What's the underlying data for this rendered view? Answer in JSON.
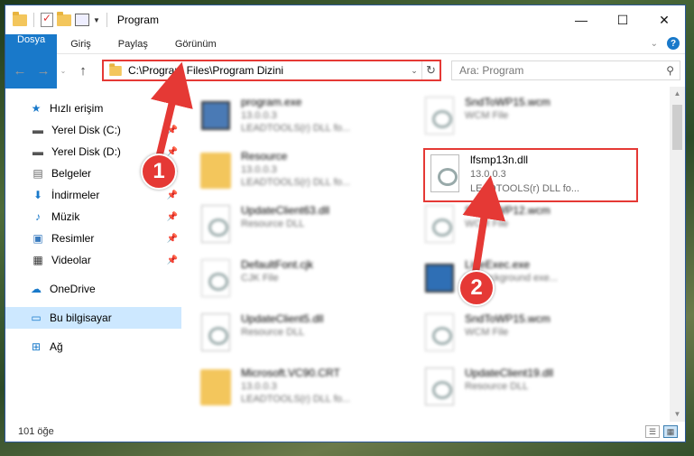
{
  "titlebar": {
    "title": "Program",
    "minimize": "—",
    "maximize": "☐",
    "close": "✕"
  },
  "ribbon": {
    "tabs": [
      "Dosya",
      "Giriş",
      "Paylaş",
      "Görünüm"
    ],
    "help": "?"
  },
  "navbar": {
    "back": "←",
    "forward": "→",
    "recent": "⌄",
    "up": "↑",
    "address": "C:\\Program Files\\Program Dizini",
    "refresh": "↻",
    "search_placeholder": "Ara: Program"
  },
  "sidebar": {
    "quick_access": "Hızlı erişim",
    "items": [
      {
        "label": "Yerel Disk (C:)",
        "icon": "drive-icon",
        "pinned": true
      },
      {
        "label": "Yerel Disk (D:)",
        "icon": "drive-icon",
        "pinned": true
      },
      {
        "label": "Belgeler",
        "icon": "documents-icon",
        "pinned": true
      },
      {
        "label": "İndirmeler",
        "icon": "download-icon",
        "pinned": true
      },
      {
        "label": "Müzik",
        "icon": "music-icon",
        "pinned": true
      },
      {
        "label": "Resimler",
        "icon": "pictures-icon",
        "pinned": true
      },
      {
        "label": "Videolar",
        "icon": "videos-icon",
        "pinned": true
      }
    ],
    "onedrive": "OneDrive",
    "this_pc": "Bu bilgisayar",
    "network": "Ağ"
  },
  "files": [
    {
      "name": "program.exe",
      "line1": "13.0.0.3",
      "line2": "LEADTOOLS(r) DLL fo...",
      "icon": "exe-icon"
    },
    {
      "name": "SndToWP15.wcm",
      "line1": "WCM File",
      "line2": "",
      "icon": "file-icon"
    },
    {
      "name": "Resource",
      "line1": "13.0.0.3",
      "line2": "LEADTOOLS(r) DLL fo...",
      "icon": "folder-icon"
    },
    {
      "name": "",
      "line1": "",
      "line2": "",
      "icon": ""
    },
    {
      "name": "UpdateClient63.dll",
      "line1": "Resource DLL",
      "line2": "",
      "icon": "dll-icon"
    },
    {
      "name": "SndToWP12.wcm",
      "line1": "WCM File",
      "line2": "",
      "icon": "file-icon"
    },
    {
      "name": "DefaultFont.cjk",
      "line1": "CJK File",
      "line2": "",
      "icon": "file-icon"
    },
    {
      "name": "LineExec.exe",
      "line1": "LY background exe...",
      "line2": "",
      "icon": "exe-icon"
    },
    {
      "name": "UpdateClient5.dll",
      "line1": "Resource DLL",
      "line2": "",
      "icon": "dll-icon"
    },
    {
      "name": "SndToWP15.wcm",
      "line1": "WCM File",
      "line2": "",
      "icon": "file-icon"
    },
    {
      "name": "Microsoft.VC90.CRT",
      "line1": "13.0.0.3",
      "line2": "LEADTOOLS(r) DLL fo...",
      "icon": "folder-icon"
    },
    {
      "name": "UpdateClient19.dll",
      "line1": "Resource DLL",
      "line2": "",
      "icon": "dll-icon"
    }
  ],
  "highlighted_file": {
    "name": "lfsmp13n.dll",
    "version": "13.0.0.3",
    "description": "LEADTOOLS(r) DLL fo..."
  },
  "status": {
    "count": "101 öğe"
  },
  "annotations": {
    "step1": "1",
    "step2": "2",
    "color": "#e53935"
  }
}
